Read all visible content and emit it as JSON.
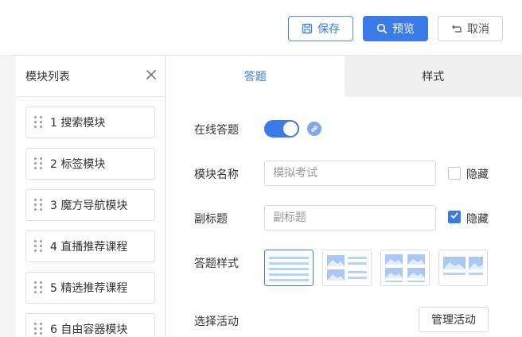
{
  "toolbar": {
    "save_label": "保存",
    "preview_label": "预览",
    "cancel_label": "取消"
  },
  "sidebar": {
    "title": "模块列表",
    "items": [
      {
        "label": "1 搜索模块"
      },
      {
        "label": "2 标签模块"
      },
      {
        "label": "3 魔方导航模块"
      },
      {
        "label": "4 直播推荐课程"
      },
      {
        "label": "5 精选推荐课程"
      },
      {
        "label": "6 自由容器模块"
      }
    ]
  },
  "tabs": [
    {
      "label": "答题",
      "active": true
    },
    {
      "label": "样式",
      "active": false
    }
  ],
  "form": {
    "online_quiz_label": "在线答题",
    "online_quiz_enabled": true,
    "module_name_label": "模块名称",
    "module_name_placeholder": "模拟考试",
    "module_name_hide_label": "隐藏",
    "module_name_hidden": false,
    "subtitle_label": "副标题",
    "subtitle_placeholder": "副标题",
    "subtitle_hide_label": "隐藏",
    "subtitle_hidden": true,
    "quiz_style_label": "答题样式",
    "quiz_style_selected": 1,
    "select_activity_label": "选择活动",
    "manage_activity_label": "管理活动"
  },
  "colors": {
    "accent": "#3a7be8",
    "accent_light": "#b9d3f7",
    "border": "#d9d9d9"
  }
}
